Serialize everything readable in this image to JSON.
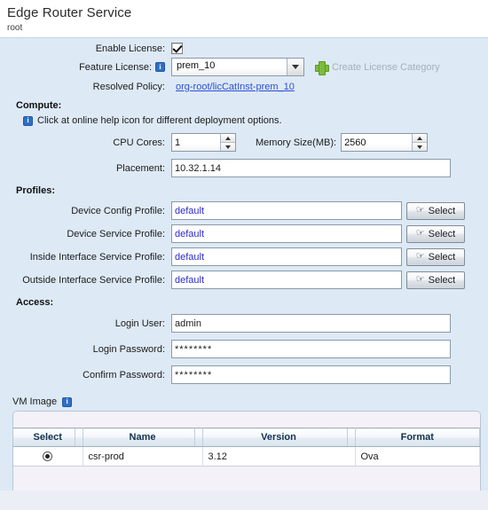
{
  "header": {
    "title": "Edge Router Service",
    "subtitle": "root"
  },
  "license": {
    "enable_label": "Enable License:",
    "enable_checked": true,
    "feature_label": "Feature License:",
    "feature_info_icon": "info-icon",
    "feature_value": "prem_10",
    "feature_options": [
      "prem_10"
    ],
    "create_category_label": "Create License Category",
    "create_category_icon": "green-plus-icon",
    "resolved_policy_label": "Resolved Policy:",
    "resolved_policy_link": "org-root/licCatInst-prem_10"
  },
  "compute": {
    "section_label": "Compute:",
    "hint_icon": "info-icon",
    "hint_text": "Click at online help icon for different deployment options.",
    "cpu_label": "CPU Cores:",
    "cpu_value": "1",
    "memory_label": "Memory Size(MB):",
    "memory_value": "2560",
    "placement_label": "Placement:",
    "placement_value": "10.32.1.14"
  },
  "profiles": {
    "section_label": "Profiles:",
    "select_button_label": "Select",
    "select_button_icon": "hand-pointer-icon",
    "rows": [
      {
        "label": "Device Config Profile:",
        "value": "default"
      },
      {
        "label": "Device Service Profile:",
        "value": "default"
      },
      {
        "label": "Inside Interface Service Profile:",
        "value": "default"
      },
      {
        "label": "Outside Interface Service Profile:",
        "value": "default"
      }
    ]
  },
  "access": {
    "section_label": "Access:",
    "rows": [
      {
        "label": "Login User:",
        "value": "admin"
      },
      {
        "label": "Login Password:",
        "value": "********"
      },
      {
        "label": "Confirm Password:",
        "value": "********"
      }
    ]
  },
  "vm_image": {
    "title": "VM Image",
    "info_icon": "info-icon",
    "columns": [
      "Select",
      "Name",
      "Version",
      "Format"
    ],
    "rows": [
      {
        "selected": true,
        "name": "csr-prod",
        "version": "3.12",
        "format": "Ova"
      }
    ]
  },
  "colors": {
    "body_background": "#dde9f4",
    "header_background": "#ffffff",
    "link": "#2c4fd6",
    "field_value_blue": "#2b2bc8",
    "info_icon": "#2f6fc4",
    "plus_icon": "#7cbb3f",
    "grid_header_text": "#11314f"
  }
}
